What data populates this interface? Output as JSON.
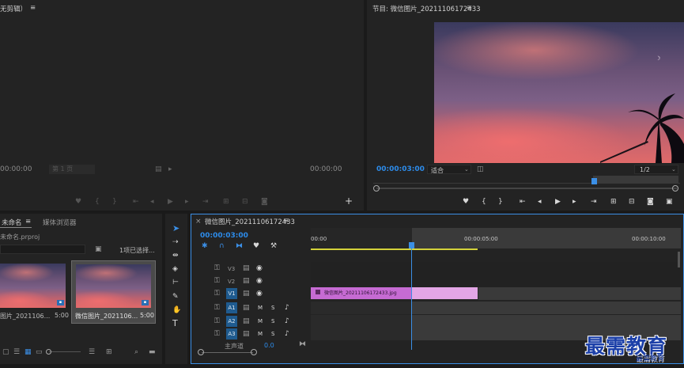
{
  "source_monitor": {
    "title": "无剪辑）",
    "timecode_left": "00:00:00",
    "zoom_label": "第 1 页",
    "timecode_right": "00:00:00"
  },
  "program_monitor": {
    "title": "节目: 微信图片_20211106172433",
    "timecode": "00:00:03:00",
    "fit_label": "适合",
    "resolution": "1/2"
  },
  "project_panel": {
    "tab_project": "未命名",
    "tab_media_browser": "媒体浏览器",
    "project_file": "未命名.prproj",
    "selection_info": "1项已选择...",
    "items": [
      {
        "name": "图片_2021106...",
        "duration": "5:00"
      },
      {
        "name": "微信图片_2021106...",
        "duration": "5:00"
      }
    ]
  },
  "timeline": {
    "title": "微信图片_20211106172433",
    "timecode": "00:00:03:00",
    "ruler": [
      "00:00",
      "00:00:05:00",
      "00:00:10:00"
    ],
    "tracks_video": [
      "V3",
      "V2",
      "V1"
    ],
    "tracks_audio": [
      "A1",
      "A2",
      "A3"
    ],
    "master_label": "主声道",
    "master_value": "0.0",
    "clip_name": "微信图片_20211106172433.jpg"
  },
  "watermark": {
    "main": "最需教育",
    "sub": "最需教育"
  },
  "colors": {
    "accent": "#2d8ceb",
    "clip": "#e3a6e6",
    "clip_dark": "#c66bd3",
    "track_active": "#1f5b8f",
    "playhead": "#3b8fe6"
  }
}
